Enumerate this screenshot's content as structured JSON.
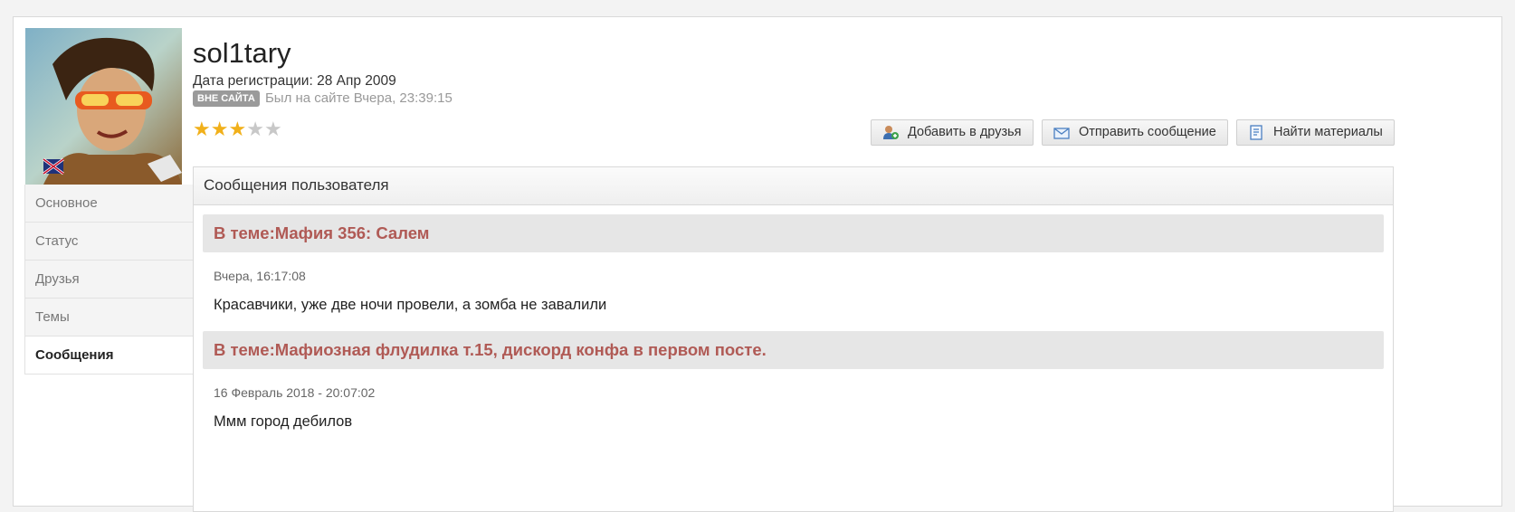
{
  "profile": {
    "username": "sol1tary",
    "registration": "Дата регистрации: 28 Апр 2009",
    "status_badge": "ВНЕ САЙТА",
    "last_seen": "Был на сайте Вчера, 23:39:15",
    "rating": {
      "filled": 3,
      "total": 5
    }
  },
  "sidebar": {
    "items": [
      {
        "label": "Основное"
      },
      {
        "label": "Статус"
      },
      {
        "label": "Друзья"
      },
      {
        "label": "Темы"
      },
      {
        "label": "Сообщения",
        "active": true
      }
    ]
  },
  "actions": {
    "add_friend": "Добавить в друзья",
    "send_message": "Отправить сообщение",
    "find_content": "Найти материалы"
  },
  "messages": {
    "header": "Сообщения пользователя",
    "posts": [
      {
        "topic": "В теме:Мафия 356: Салем",
        "date": "Вчера, 16:17:08",
        "text": "Красавчики, уже две ночи провели, а зомба не завалили"
      },
      {
        "topic": "В теме:Мафиозная флудилка т.15, дискорд конфа в первом посте.",
        "date": "16 Февраль 2018 - 20:07:02",
        "text": "Ммм город дебилов"
      }
    ]
  },
  "colors": {
    "topic_text": "#b05a55",
    "star_on": "#f1b01a",
    "badge_bg": "#9a9a9a"
  }
}
